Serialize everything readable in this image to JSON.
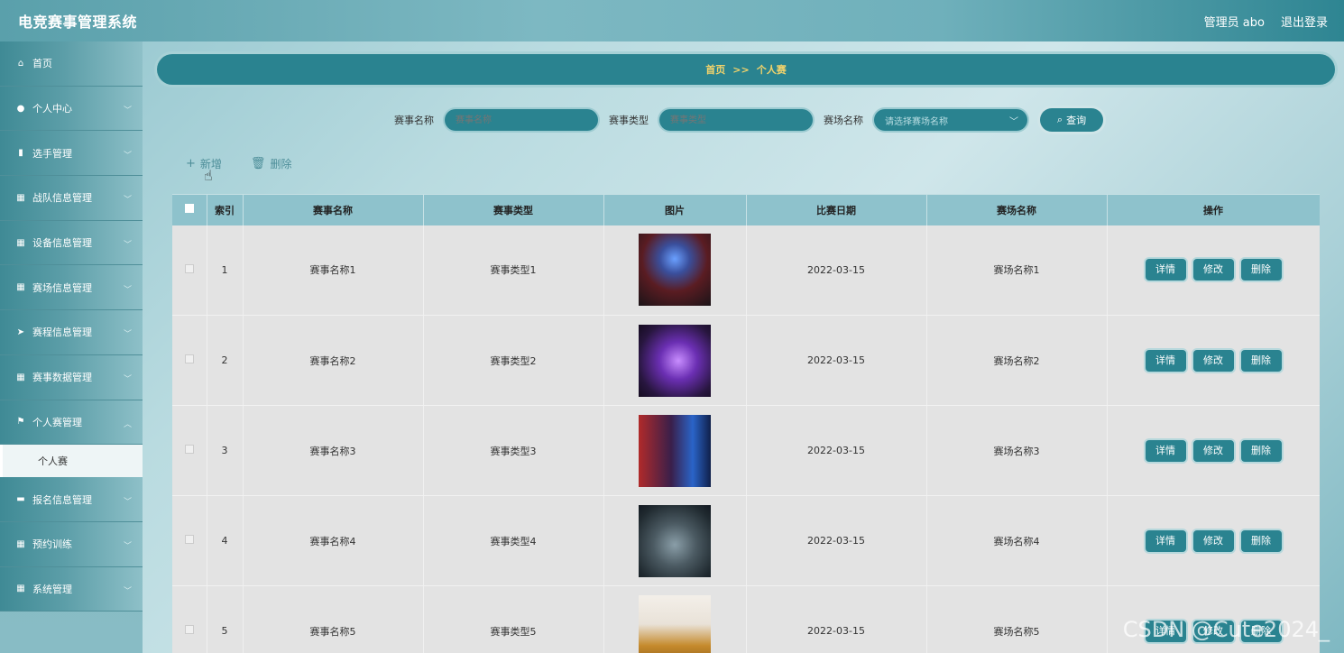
{
  "header": {
    "title": "电竞赛事管理系统",
    "user": "管理员 abo",
    "logout": "退出登录"
  },
  "sidebar": {
    "items": [
      {
        "label": "首页",
        "icon": "home-icon",
        "glyph": "⌂"
      },
      {
        "label": "个人中心",
        "icon": "user-icon",
        "glyph": "●",
        "chev": true
      },
      {
        "label": "选手管理",
        "icon": "clipboard-icon",
        "glyph": "▮",
        "chev": true
      },
      {
        "label": "战队信息管理",
        "icon": "grid-icon",
        "glyph": "▦",
        "chev": true
      },
      {
        "label": "设备信息管理",
        "icon": "grid-icon",
        "glyph": "▦",
        "chev": true
      },
      {
        "label": "赛场信息管理",
        "icon": "table-icon",
        "glyph": "▦",
        "chev": true
      },
      {
        "label": "赛程信息管理",
        "icon": "send-icon",
        "glyph": "➤",
        "chev": true
      },
      {
        "label": "赛事数据管理",
        "icon": "grid-icon",
        "glyph": "▦",
        "chev": true
      },
      {
        "label": "个人赛管理",
        "icon": "flag-icon",
        "glyph": "⚑",
        "chev": true
      }
    ],
    "sub_item": "个人赛",
    "items_after": [
      {
        "label": "报名信息管理",
        "icon": "briefcase-icon",
        "glyph": "▬",
        "chev": true
      },
      {
        "label": "预约训练",
        "icon": "grid-icon",
        "glyph": "▦",
        "chev": true
      },
      {
        "label": "系统管理",
        "icon": "grid-icon",
        "glyph": "▦",
        "chev": true
      }
    ]
  },
  "breadcrumb": {
    "home": "首页",
    "sep": ">>",
    "current": "个人赛"
  },
  "search": {
    "name_label": "赛事名称",
    "name_placeholder": "赛事名称",
    "type_label": "赛事类型",
    "type_placeholder": "赛事类型",
    "venue_label": "赛场名称",
    "venue_placeholder": "请选择赛场名称",
    "button": "查询"
  },
  "actions": {
    "add": "新增",
    "delete": "删除"
  },
  "table": {
    "columns": [
      "索引",
      "赛事名称",
      "赛事类型",
      "图片",
      "比赛日期",
      "赛场名称",
      "操作"
    ],
    "ops": {
      "detail": "详情",
      "edit": "修改",
      "delete": "删除"
    },
    "rows": [
      {
        "index": "1",
        "name": "赛事名称1",
        "type": "赛事类型1",
        "date": "2022-03-15",
        "venue": "赛场名称1"
      },
      {
        "index": "2",
        "name": "赛事名称2",
        "type": "赛事类型2",
        "date": "2022-03-15",
        "venue": "赛场名称2"
      },
      {
        "index": "3",
        "name": "赛事名称3",
        "type": "赛事类型3",
        "date": "2022-03-15",
        "venue": "赛场名称3"
      },
      {
        "index": "4",
        "name": "赛事名称4",
        "type": "赛事类型4",
        "date": "2022-03-15",
        "venue": "赛场名称4"
      },
      {
        "index": "5",
        "name": "赛事名称5",
        "type": "赛事类型5",
        "date": "2022-03-15",
        "venue": "赛场名称5"
      }
    ]
  },
  "watermark": "CSDN @Cute2024_"
}
